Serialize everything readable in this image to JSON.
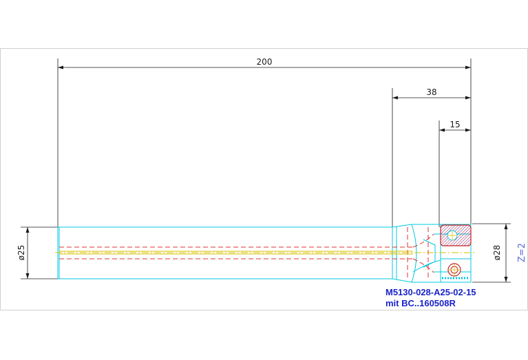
{
  "drawing": {
    "dimensions": {
      "overall_length": "200",
      "head_length": "38",
      "insert_length": "15",
      "shank_diameter": "ø25",
      "cutting_diameter": "ø28"
    },
    "tooth_count": "Z=2",
    "part_number": "M5130-028-A25-02-15",
    "insert_note": "mit BC..160508R",
    "colors": {
      "dimension": "#1a1a1a",
      "outline": "#00c8e0",
      "hidden": "#e03030",
      "centerline": "#d8c000",
      "label": "#1a24c8"
    }
  }
}
